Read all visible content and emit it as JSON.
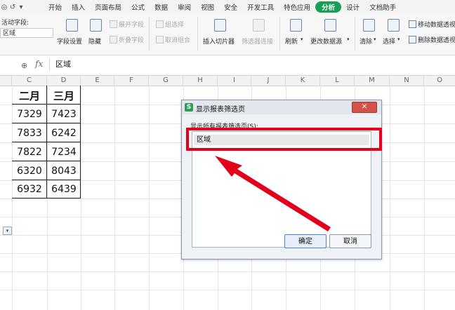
{
  "menubar": {
    "quick_icons": [
      "◎",
      "↺",
      "▾"
    ],
    "items": [
      {
        "label": "开始"
      },
      {
        "label": "插入"
      },
      {
        "label": "页面布局"
      },
      {
        "label": "公式"
      },
      {
        "label": "数据"
      },
      {
        "label": "审阅"
      },
      {
        "label": "视图"
      },
      {
        "label": "安全"
      },
      {
        "label": "开发工具"
      },
      {
        "label": "特色应用"
      },
      {
        "label": "分析",
        "active": true
      },
      {
        "label": "设计"
      },
      {
        "label": "文档助手"
      }
    ]
  },
  "ribbon": {
    "active_field_label": "活动字段:",
    "active_field_value": "区域",
    "field_settings": "字段设置",
    "hide": "隐藏",
    "expand_field": "展开字段",
    "collapse_field": "折叠字段",
    "group_selection": "组选择",
    "ungroup": "取消组合",
    "insert_slicer": "插入切片器",
    "filter_connections": "筛选器连接",
    "refresh": "刷新",
    "change_source": "更改数据源",
    "clear": "清除",
    "select": "选择",
    "move_pivot": "移动数据透视",
    "delete_pivot": "删除数据透视"
  },
  "formula_bar": {
    "zoom_icon": "⊕",
    "fx_label": "fx",
    "value": "区域"
  },
  "columns": [
    "C",
    "D",
    "E",
    "F",
    "G",
    "H",
    "I",
    "J",
    "K",
    "L",
    "M",
    "N",
    "O"
  ],
  "table": {
    "headers": [
      "二月",
      "三月"
    ],
    "rows": [
      [
        "7329",
        "7423"
      ],
      [
        "7833",
        "6242"
      ],
      [
        "7822",
        "7234"
      ],
      [
        "6320",
        "8043"
      ],
      [
        "6932",
        "6439"
      ]
    ]
  },
  "dropdown_arrow": "▾",
  "dialog": {
    "logo": "S",
    "title": "显示报表筛选页",
    "close": "✕",
    "list_label": "显示所有报表筛选页(S):",
    "items": [
      "区域"
    ],
    "ok": "确定",
    "cancel": "取消"
  },
  "colors": {
    "accent_green": "#1a9e57",
    "highlight_red": "#e3001b"
  }
}
